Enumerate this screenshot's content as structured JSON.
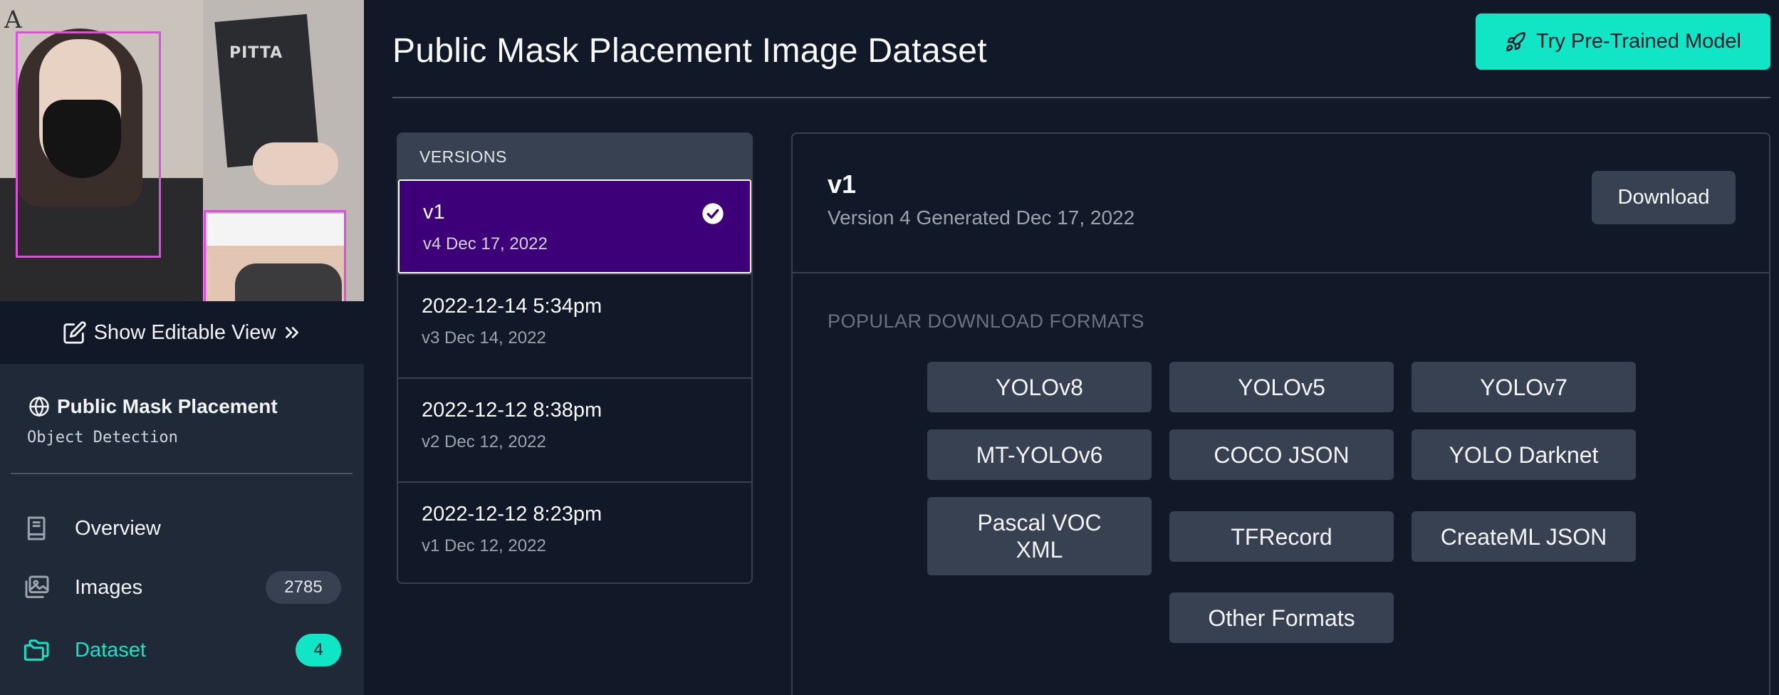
{
  "sidebar": {
    "thumbnail": {
      "package_text": "PITTA",
      "corner_letter": "A"
    },
    "editable_view_label": "Show Editable View",
    "project_name": "Public Mask Placement",
    "project_type": "Object Detection",
    "nav": [
      {
        "label": "Overview",
        "icon": "book-icon"
      },
      {
        "label": "Images",
        "icon": "images-icon",
        "count": "2785"
      },
      {
        "label": "Dataset",
        "icon": "folder-icon",
        "count": "4"
      }
    ]
  },
  "header": {
    "title": "Public Mask Placement Image Dataset",
    "try_button": "Try Pre-Trained Model"
  },
  "versions": {
    "header": "VERSIONS",
    "items": [
      {
        "name": "v1",
        "sub": "v4 Dec 17, 2022",
        "selected": true
      },
      {
        "name": "2022-12-14 5:34pm",
        "sub": "v3 Dec 14, 2022"
      },
      {
        "name": "2022-12-12 8:38pm",
        "sub": "v2 Dec 12, 2022"
      },
      {
        "name": "2022-12-12 8:23pm",
        "sub": "v1 Dec 12, 2022"
      }
    ]
  },
  "detail": {
    "name": "v1",
    "subtitle": "Version 4 Generated Dec 17, 2022",
    "download_button": "Download",
    "formats_label": "POPULAR DOWNLOAD FORMATS",
    "formats": [
      "YOLOv8",
      "YOLOv5",
      "YOLOv7",
      "MT-YOLOv6",
      "COCO JSON",
      "YOLO Darknet",
      "Pascal VOC XML",
      "TFRecord",
      "CreateML JSON",
      "Other Formats"
    ]
  },
  "colors": {
    "accent": "#10e6c5",
    "selected_version": "#3d0079",
    "bounding_box": "#e24ce2"
  }
}
